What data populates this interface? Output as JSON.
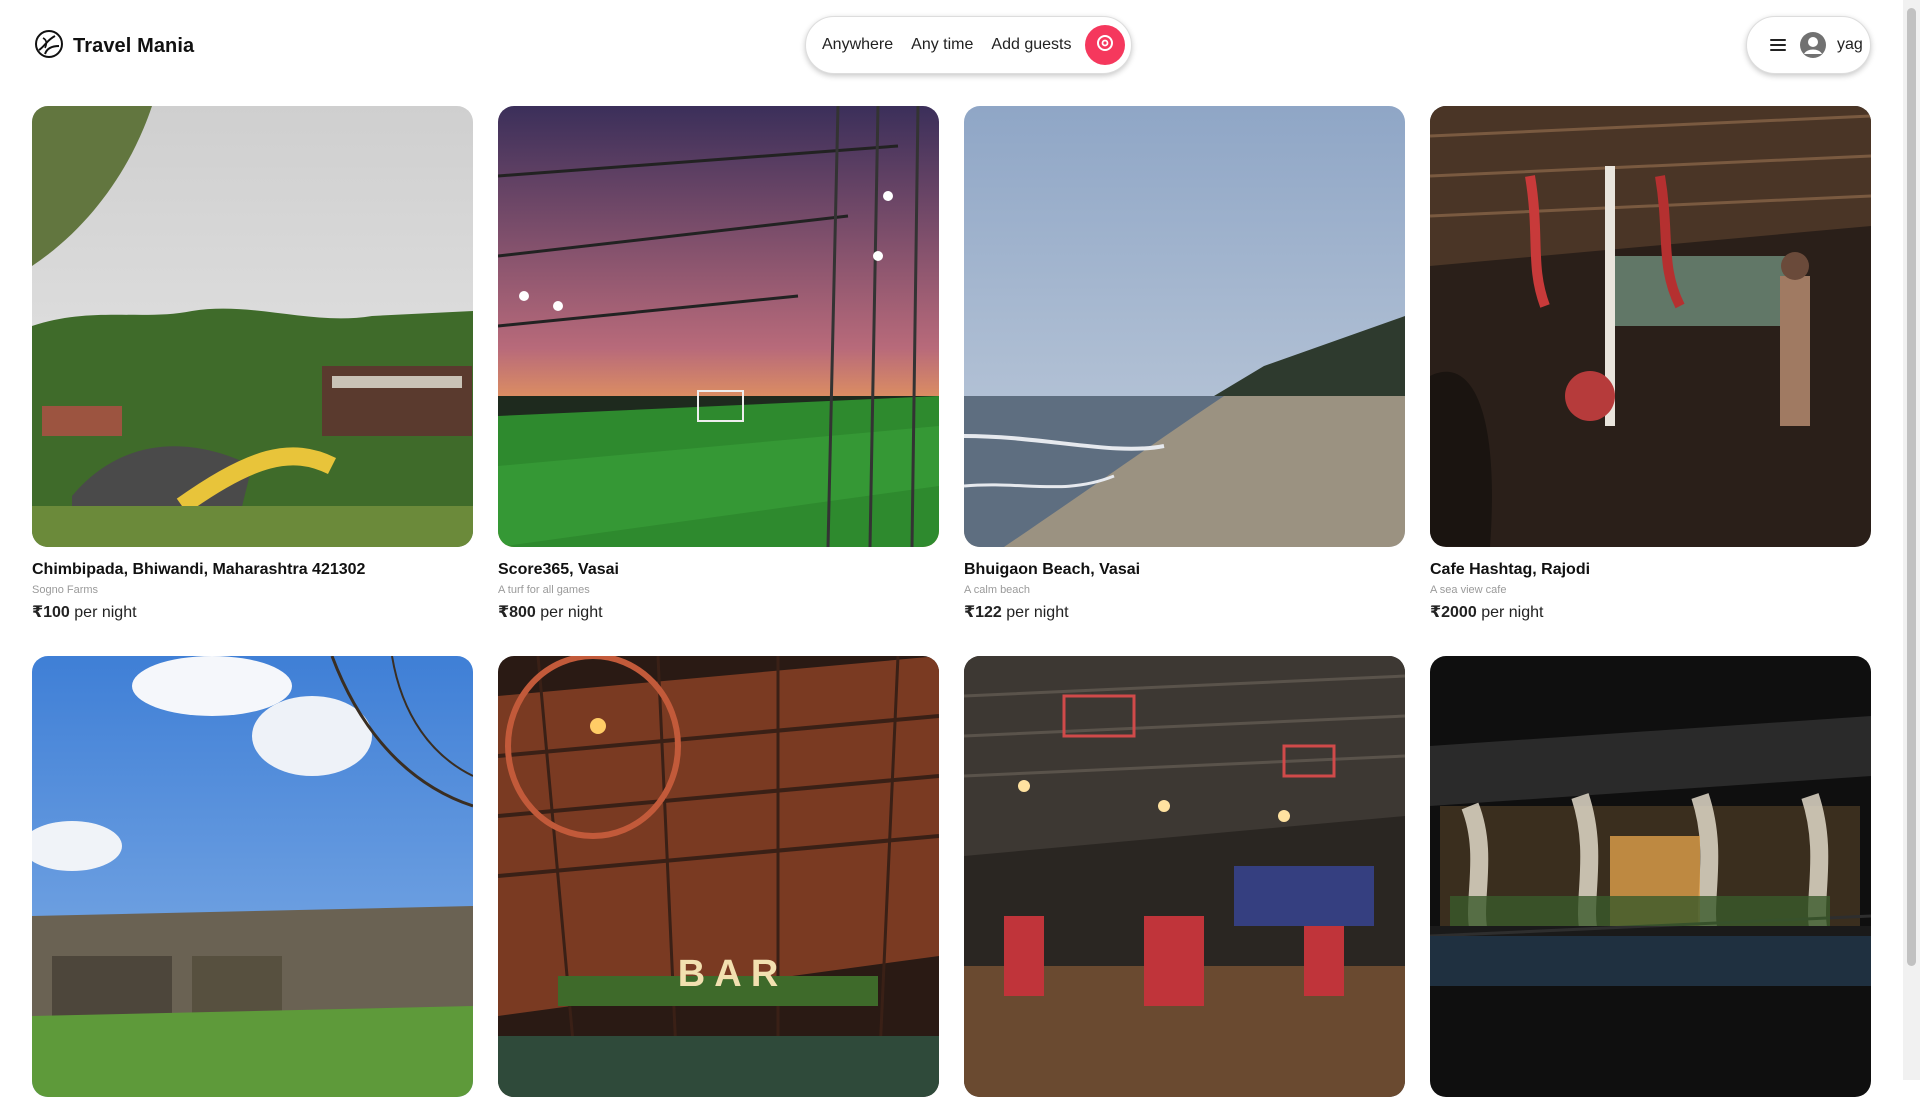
{
  "brand": {
    "name": "Travel Mania"
  },
  "search": {
    "where": "Anywhere",
    "when": "Any time",
    "guests": "Add guests",
    "accent": "#f5385d"
  },
  "user": {
    "name": "yag"
  },
  "listings": [
    {
      "title": "Chimbipada, Bhiwandi, Maharashtra 421302",
      "subtitle": "Sogno Farms",
      "price": "₹100",
      "price_unit": "per night",
      "image": "garden-resort-photo"
    },
    {
      "title": "Score365, Vasai",
      "subtitle": "A turf for all games",
      "price": "₹800",
      "price_unit": "per night",
      "image": "turf-sunset-photo"
    },
    {
      "title": "Bhuigaon Beach, Vasai",
      "subtitle": "A calm beach",
      "price": "₹122",
      "price_unit": "per night",
      "image": "beach-photo"
    },
    {
      "title": "Cafe Hashtag, Rajodi",
      "subtitle": "A sea view cafe",
      "price": "₹2000",
      "price_unit": "per night",
      "image": "cafe-night-photo"
    },
    {
      "title": "",
      "subtitle": "",
      "price": "",
      "price_unit": "",
      "image": "caves-sky-photo"
    },
    {
      "title": "",
      "subtitle": "",
      "price": "",
      "price_unit": "",
      "image": "bar-interior-photo"
    },
    {
      "title": "",
      "subtitle": "",
      "price": "",
      "price_unit": "",
      "image": "restaurant-hall-photo"
    },
    {
      "title": "",
      "subtitle": "",
      "price": "",
      "price_unit": "",
      "image": "balcony-night-photo"
    }
  ]
}
